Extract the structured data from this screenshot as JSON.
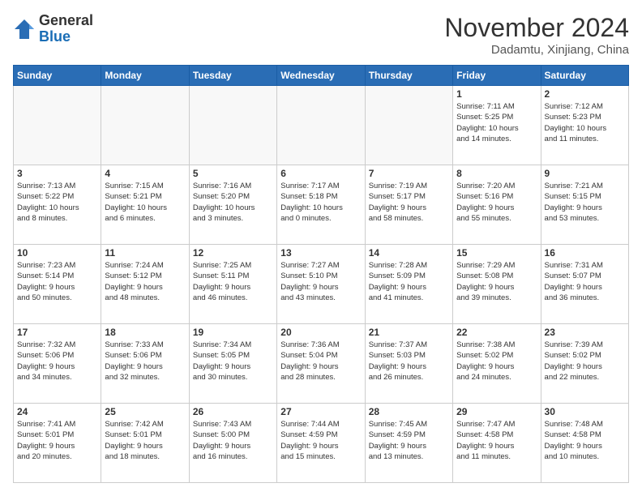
{
  "header": {
    "logo_general": "General",
    "logo_blue": "Blue",
    "month": "November 2024",
    "location": "Dadamtu, Xinjiang, China"
  },
  "weekdays": [
    "Sunday",
    "Monday",
    "Tuesday",
    "Wednesday",
    "Thursday",
    "Friday",
    "Saturday"
  ],
  "weeks": [
    [
      {
        "day": "",
        "info": ""
      },
      {
        "day": "",
        "info": ""
      },
      {
        "day": "",
        "info": ""
      },
      {
        "day": "",
        "info": ""
      },
      {
        "day": "",
        "info": ""
      },
      {
        "day": "1",
        "info": "Sunrise: 7:11 AM\nSunset: 5:25 PM\nDaylight: 10 hours\nand 14 minutes."
      },
      {
        "day": "2",
        "info": "Sunrise: 7:12 AM\nSunset: 5:23 PM\nDaylight: 10 hours\nand 11 minutes."
      }
    ],
    [
      {
        "day": "3",
        "info": "Sunrise: 7:13 AM\nSunset: 5:22 PM\nDaylight: 10 hours\nand 8 minutes."
      },
      {
        "day": "4",
        "info": "Sunrise: 7:15 AM\nSunset: 5:21 PM\nDaylight: 10 hours\nand 6 minutes."
      },
      {
        "day": "5",
        "info": "Sunrise: 7:16 AM\nSunset: 5:20 PM\nDaylight: 10 hours\nand 3 minutes."
      },
      {
        "day": "6",
        "info": "Sunrise: 7:17 AM\nSunset: 5:18 PM\nDaylight: 10 hours\nand 0 minutes."
      },
      {
        "day": "7",
        "info": "Sunrise: 7:19 AM\nSunset: 5:17 PM\nDaylight: 9 hours\nand 58 minutes."
      },
      {
        "day": "8",
        "info": "Sunrise: 7:20 AM\nSunset: 5:16 PM\nDaylight: 9 hours\nand 55 minutes."
      },
      {
        "day": "9",
        "info": "Sunrise: 7:21 AM\nSunset: 5:15 PM\nDaylight: 9 hours\nand 53 minutes."
      }
    ],
    [
      {
        "day": "10",
        "info": "Sunrise: 7:23 AM\nSunset: 5:14 PM\nDaylight: 9 hours\nand 50 minutes."
      },
      {
        "day": "11",
        "info": "Sunrise: 7:24 AM\nSunset: 5:12 PM\nDaylight: 9 hours\nand 48 minutes."
      },
      {
        "day": "12",
        "info": "Sunrise: 7:25 AM\nSunset: 5:11 PM\nDaylight: 9 hours\nand 46 minutes."
      },
      {
        "day": "13",
        "info": "Sunrise: 7:27 AM\nSunset: 5:10 PM\nDaylight: 9 hours\nand 43 minutes."
      },
      {
        "day": "14",
        "info": "Sunrise: 7:28 AM\nSunset: 5:09 PM\nDaylight: 9 hours\nand 41 minutes."
      },
      {
        "day": "15",
        "info": "Sunrise: 7:29 AM\nSunset: 5:08 PM\nDaylight: 9 hours\nand 39 minutes."
      },
      {
        "day": "16",
        "info": "Sunrise: 7:31 AM\nSunset: 5:07 PM\nDaylight: 9 hours\nand 36 minutes."
      }
    ],
    [
      {
        "day": "17",
        "info": "Sunrise: 7:32 AM\nSunset: 5:06 PM\nDaylight: 9 hours\nand 34 minutes."
      },
      {
        "day": "18",
        "info": "Sunrise: 7:33 AM\nSunset: 5:06 PM\nDaylight: 9 hours\nand 32 minutes."
      },
      {
        "day": "19",
        "info": "Sunrise: 7:34 AM\nSunset: 5:05 PM\nDaylight: 9 hours\nand 30 minutes."
      },
      {
        "day": "20",
        "info": "Sunrise: 7:36 AM\nSunset: 5:04 PM\nDaylight: 9 hours\nand 28 minutes."
      },
      {
        "day": "21",
        "info": "Sunrise: 7:37 AM\nSunset: 5:03 PM\nDaylight: 9 hours\nand 26 minutes."
      },
      {
        "day": "22",
        "info": "Sunrise: 7:38 AM\nSunset: 5:02 PM\nDaylight: 9 hours\nand 24 minutes."
      },
      {
        "day": "23",
        "info": "Sunrise: 7:39 AM\nSunset: 5:02 PM\nDaylight: 9 hours\nand 22 minutes."
      }
    ],
    [
      {
        "day": "24",
        "info": "Sunrise: 7:41 AM\nSunset: 5:01 PM\nDaylight: 9 hours\nand 20 minutes."
      },
      {
        "day": "25",
        "info": "Sunrise: 7:42 AM\nSunset: 5:01 PM\nDaylight: 9 hours\nand 18 minutes."
      },
      {
        "day": "26",
        "info": "Sunrise: 7:43 AM\nSunset: 5:00 PM\nDaylight: 9 hours\nand 16 minutes."
      },
      {
        "day": "27",
        "info": "Sunrise: 7:44 AM\nSunset: 4:59 PM\nDaylight: 9 hours\nand 15 minutes."
      },
      {
        "day": "28",
        "info": "Sunrise: 7:45 AM\nSunset: 4:59 PM\nDaylight: 9 hours\nand 13 minutes."
      },
      {
        "day": "29",
        "info": "Sunrise: 7:47 AM\nSunset: 4:58 PM\nDaylight: 9 hours\nand 11 minutes."
      },
      {
        "day": "30",
        "info": "Sunrise: 7:48 AM\nSunset: 4:58 PM\nDaylight: 9 hours\nand 10 minutes."
      }
    ]
  ]
}
